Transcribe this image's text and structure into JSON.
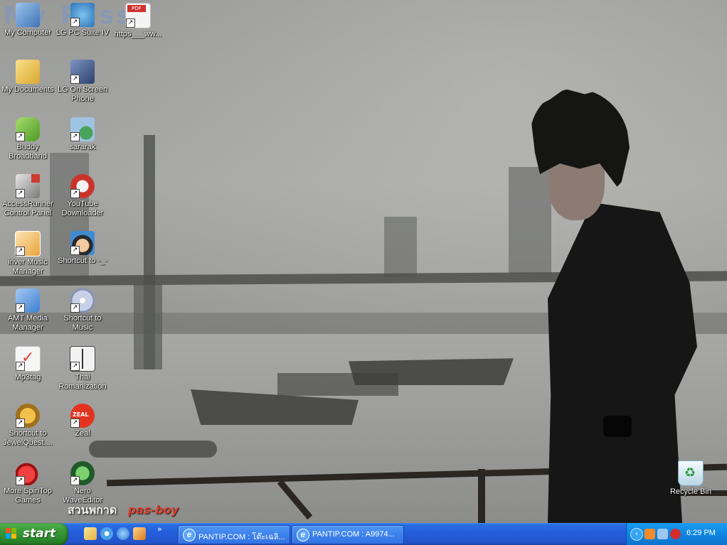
{
  "watermark": "My Pass",
  "signature": {
    "thai": "สวนพกาด",
    "name": "pas-boy"
  },
  "icons": [
    {
      "label": "My Computer",
      "color": "#6fa7de"
    },
    {
      "label": "LG PC Suite IV",
      "color": "#3a86c8"
    },
    {
      "label": "https___ww...",
      "color": "#d0312d"
    },
    {
      "label": "My Documents",
      "color": "#f0cd58"
    },
    {
      "label": "LG On Screen\nPhone",
      "color": "#4e6fa8"
    },
    {
      "label": "Buddy\nBroadband",
      "color": "#6cb93a"
    },
    {
      "label": "sararak",
      "color": "#8fb7d8"
    },
    {
      "label": "AccessRunner\nControl Panel",
      "color": "#cc3b2e"
    },
    {
      "label": "YouTube\nDownloader",
      "color": "#c9342a"
    },
    {
      "label": "iriver Music\nManager",
      "color": "#e9a43b"
    },
    {
      "label": "Shortcut to -_-",
      "color": "#3f8bd1"
    },
    {
      "label": "AMT Media\nManager",
      "color": "#3b7fd0"
    },
    {
      "label": "Shortcut to\nMusic",
      "color": "#9aa8c9"
    },
    {
      "label": "Mp3tag",
      "color": "#d8452f"
    },
    {
      "label": "Thai\nRomanization",
      "color": "#f2f2f2"
    },
    {
      "label": "Shortcut to\nJewelQuest....",
      "color": "#c8901e"
    },
    {
      "label": "Zeal",
      "color": "#e3341f"
    },
    {
      "label": "More SpinTop\nGames",
      "color": "#d21f1f"
    },
    {
      "label": "Nero\nWaveEditor",
      "color": "#2f8a3d"
    },
    {
      "label": "Recycle Bin",
      "color": "#d9e8f2"
    }
  ],
  "taskbar": {
    "start_label": "start",
    "quick_launch": [
      {
        "name": "show-desktop-icon",
        "color": "#f2d36b"
      },
      {
        "name": "windows-media-icon",
        "color": "#4ea0e8"
      },
      {
        "name": "internet-explorer-icon",
        "color": "#3e8fe6"
      },
      {
        "name": "outlook-express-icon",
        "color": "#e8a23a"
      }
    ],
    "more": "»",
    "tasks": [
      {
        "title": "PANTIP.COM : โต๊ะเฉลิ..."
      },
      {
        "title": "PANTIP.COM : A9974..."
      }
    ],
    "tray_chevron": "‹",
    "tray_icons": [
      {
        "name": "tray-app-icon-1",
        "color": "#f28b2a"
      },
      {
        "name": "tray-network-icon",
        "color": "#9cc8f0"
      },
      {
        "name": "tray-security-icon",
        "color": "#d42d2d"
      }
    ],
    "clock": "6:29 PM"
  }
}
